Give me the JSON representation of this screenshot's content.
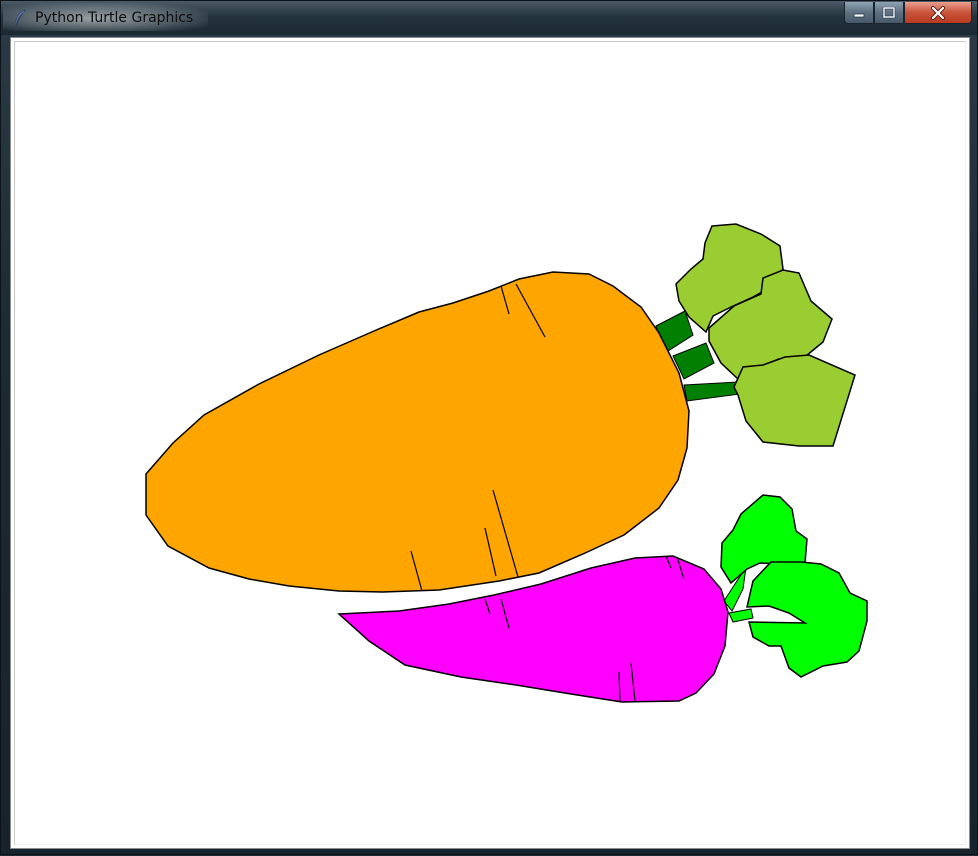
{
  "window": {
    "title": "Python Turtle Graphics",
    "icon": "feather-icon",
    "controls": {
      "minimize_icon": "minimize-icon",
      "maximize_icon": "maximize-icon",
      "close_icon": "close-icon"
    }
  },
  "colors": {
    "carrot_body": "#FFA500",
    "carrot_stem": "#007F00",
    "carrot_leaves": "#9ACD32",
    "radish_body": "#FF00FF",
    "radish_leaves": "#00FF00",
    "outline": "#000000",
    "canvas_background": "#FFFFFF"
  }
}
